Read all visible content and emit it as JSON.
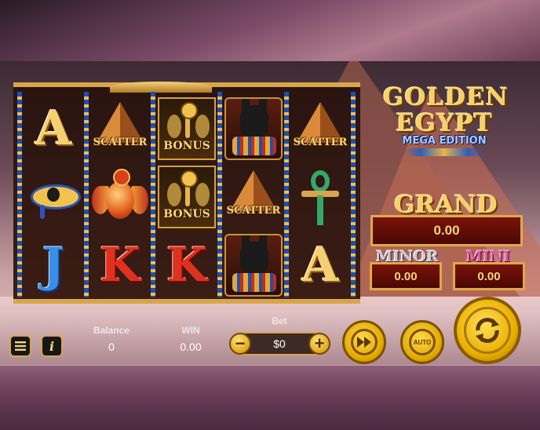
{
  "logo": {
    "line1": "GOLDEN",
    "line2": "EGYPT",
    "sub": "MEGA EDITION"
  },
  "jackpots": {
    "grand": {
      "label": "GRAND",
      "value": "0.00"
    },
    "minor": {
      "label": "MINOR",
      "value": "0.00"
    },
    "mini": {
      "label": "MINI",
      "value": "0.00"
    }
  },
  "reels": [
    [
      "A",
      "eye",
      "J"
    ],
    [
      "scatter",
      "scarab",
      "K"
    ],
    [
      "bonus",
      "bonus",
      "K"
    ],
    [
      "anubis",
      "scatter",
      "anubis"
    ],
    [
      "scatter",
      "ankh",
      "A"
    ]
  ],
  "symbol_labels": {
    "scatter": "SCATTER",
    "bonus": "BONUS"
  },
  "letters": {
    "A": "A",
    "J": "J",
    "K": "K"
  },
  "bar": {
    "balance_label": "Balance",
    "balance_value": "0",
    "win_label": "WIN",
    "win_value": "0.00",
    "bet_label": "Bet",
    "bet_value": "$0",
    "minus": "−",
    "plus": "+",
    "auto": "AUTO"
  },
  "icons": {
    "menu": "menu-icon",
    "info": "info-icon",
    "turbo": "fast-forward-icon",
    "spin": "spin-arrows-icon"
  },
  "colors": {
    "gold": "#d9a54a",
    "jackpot_bg": "#7a1208",
    "lapis": "#1e4fb0"
  }
}
